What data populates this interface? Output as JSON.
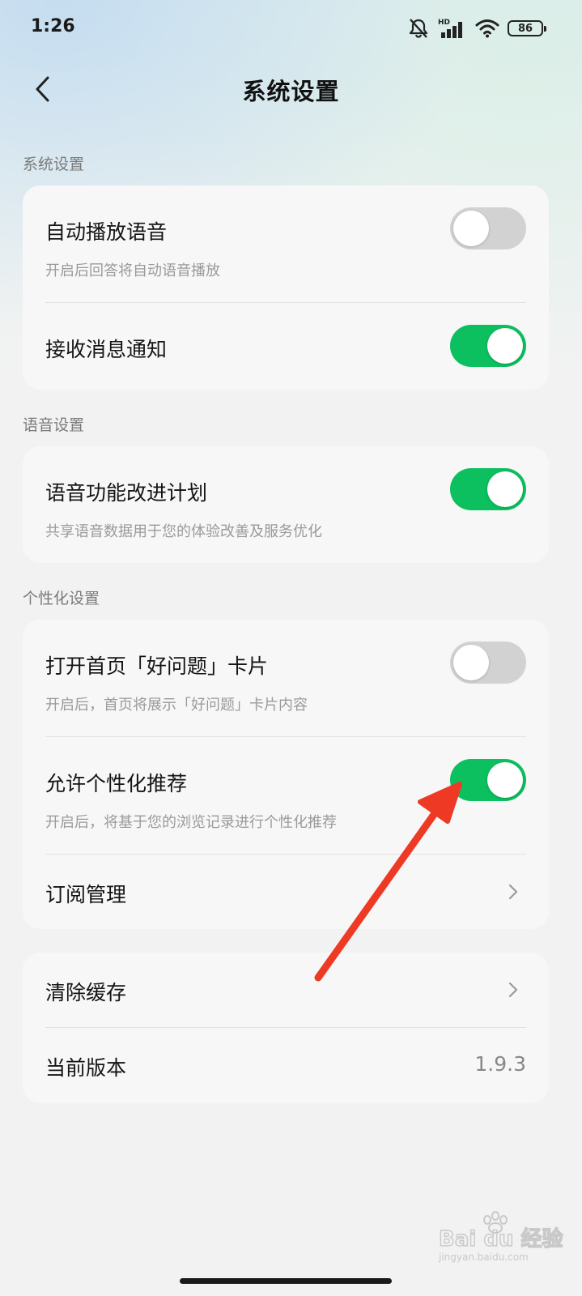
{
  "status_bar": {
    "time": "1:26",
    "battery": "86",
    "network_label": "HD"
  },
  "nav": {
    "title": "系统设置"
  },
  "sections": [
    {
      "label": "系统设置",
      "rows": [
        {
          "title": "自动播放语音",
          "subtitle": "开启后回答将自动语音播放",
          "toggle": false
        },
        {
          "title": "接收消息通知",
          "toggle": true
        }
      ]
    },
    {
      "label": "语音设置",
      "rows": [
        {
          "title": "语音功能改进计划",
          "subtitle": "共享语音数据用于您的体验改善及服务优化",
          "toggle": true
        }
      ]
    },
    {
      "label": "个性化设置",
      "rows": [
        {
          "title": "打开首页「好问题」卡片",
          "subtitle": "开启后，首页将展示「好问题」卡片内容",
          "toggle": false
        },
        {
          "title": "允许个性化推荐",
          "subtitle": "开启后，将基于您的浏览记录进行个性化推荐",
          "toggle": true
        },
        {
          "title": "订阅管理"
        }
      ]
    }
  ],
  "misc_card": {
    "rows": [
      {
        "title": "清除缓存"
      },
      {
        "title": "当前版本",
        "value": "1.9.3"
      }
    ]
  },
  "colors": {
    "toggle_on": "#0cbf5f",
    "toggle_off": "#d2d2d2",
    "annotation_arrow": "#ee3a24"
  },
  "watermark": {
    "brand": "Bai du 经验",
    "url": "jingyan.baidu.com"
  }
}
